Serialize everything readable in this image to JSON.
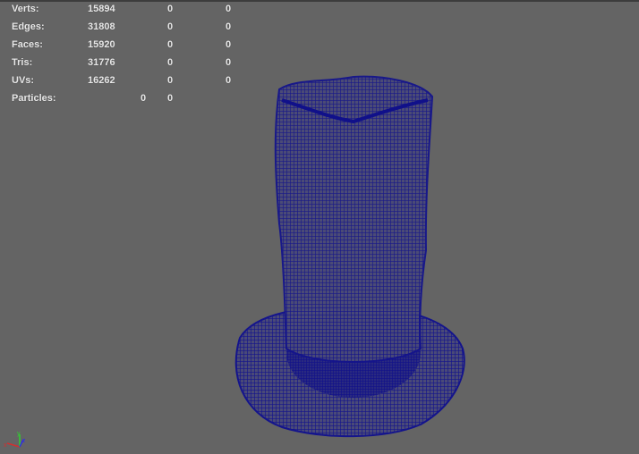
{
  "hud": {
    "rows": [
      {
        "label": "Verts:",
        "v1": "15894",
        "v2": "0",
        "v3": "0"
      },
      {
        "label": "Edges:",
        "v1": "31808",
        "v2": "0",
        "v3": "0"
      },
      {
        "label": "Faces:",
        "v1": "15920",
        "v2": "0",
        "v3": "0"
      },
      {
        "label": "Tris:",
        "v1": "31776",
        "v2": "0",
        "v3": "0"
      },
      {
        "label": "UVs:",
        "v1": "16262",
        "v2": "0",
        "v3": "0"
      }
    ],
    "particles": {
      "label": "Particles:",
      "v1": "0",
      "v2": "0"
    }
  },
  "axis": {
    "x": "x",
    "y": "y",
    "z": "z"
  },
  "colors": {
    "background": "#646464",
    "wireframe": "#14148c"
  }
}
